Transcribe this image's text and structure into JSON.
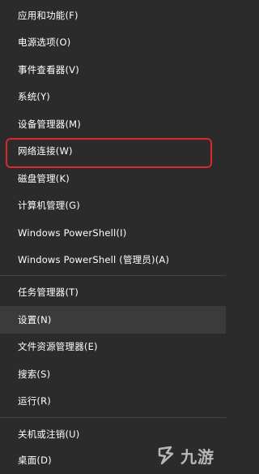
{
  "menu": {
    "items": [
      {
        "label": "应用和功能(F)"
      },
      {
        "label": "电源选项(O)"
      },
      {
        "label": "事件查看器(V)"
      },
      {
        "label": "系统(Y)"
      },
      {
        "label": "设备管理器(M)"
      },
      {
        "label": "网络连接(W)"
      },
      {
        "label": "磁盘管理(K)"
      },
      {
        "label": "计算机管理(G)"
      },
      {
        "label": "Windows PowerShell(I)"
      },
      {
        "label": "Windows PowerShell (管理员)(A)"
      },
      {
        "label": "任务管理器(T)"
      },
      {
        "label": "设置(N)"
      },
      {
        "label": "文件资源管理器(E)"
      },
      {
        "label": "搜索(S)"
      },
      {
        "label": "运行(R)"
      },
      {
        "label": "关机或注销(U)"
      },
      {
        "label": "桌面(D)"
      }
    ]
  },
  "annotation": {
    "highlight_color": "#d8282f"
  },
  "watermark": {
    "text": "九游",
    "icon": "jiuyou-logo-icon"
  }
}
